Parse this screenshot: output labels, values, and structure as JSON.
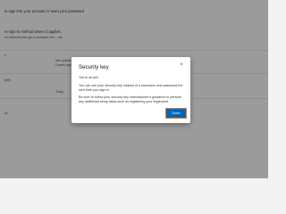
{
  "background": {
    "line1": "to sign into your account or reset your password",
    "line2": "re sign-in method where it applies.",
    "line3": "ne-authenticator-go-to-browser-hint - use",
    "item_last_updated": "last updated",
    "item_ago": "5 years ago",
    "item_ms": "(MS)",
    "item_today": "Today",
    "item_s": "s",
    "item_us": "us"
  },
  "dialog": {
    "title": "Security key",
    "close_label": "×",
    "status": "You're all set!",
    "body": "You can use your security key instead of a username and password the next time you sign in.",
    "note": "Be sure to follow your security key manufacturer's guidance to perform any additional setup tasks such as registering your fingerprint.",
    "done_label": "Done"
  }
}
